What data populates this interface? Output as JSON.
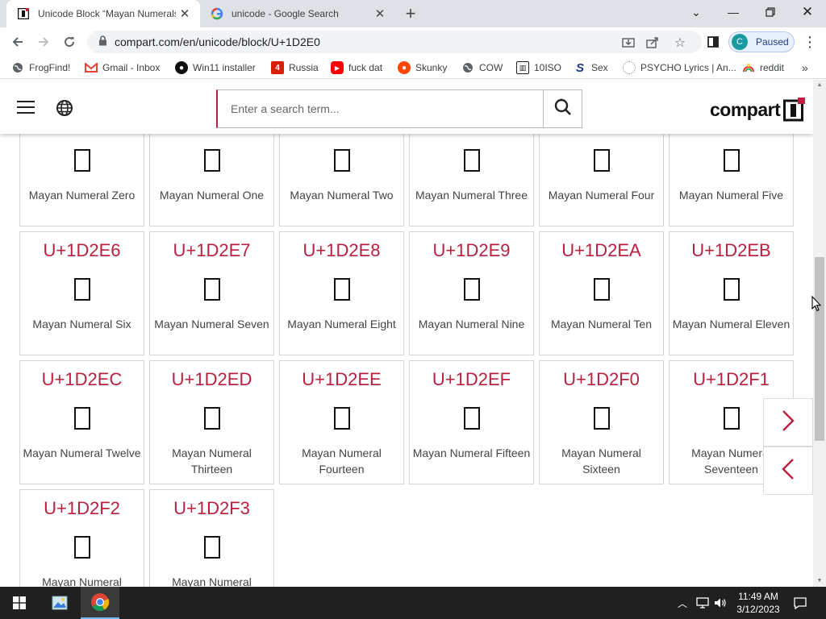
{
  "browser": {
    "tabs": [
      {
        "title": "Unicode Block “Mayan Numerals”",
        "active": true
      },
      {
        "title": "unicode - Google Search",
        "active": false
      }
    ],
    "url": "compart.com/en/unicode/block/U+1D2E0",
    "profile": {
      "initial": "C",
      "label": "Paused"
    },
    "bookmarks": [
      {
        "label": "FrogFind!",
        "icon": "globe-icon"
      },
      {
        "label": "Gmail - Inbox",
        "icon": "gmail-icon"
      },
      {
        "label": "Win11 installer",
        "icon": "github-icon"
      },
      {
        "label": "Russia",
        "icon": "russia-icon"
      },
      {
        "label": "fuck dat",
        "icon": "youtube-icon"
      },
      {
        "label": "Skunky",
        "icon": "reddit-icon"
      },
      {
        "label": "COW",
        "icon": "globe-icon"
      },
      {
        "label": "10ISO",
        "icon": "building-icon"
      },
      {
        "label": "Sex",
        "icon": "s-icon"
      },
      {
        "label": "PSYCHO Lyrics | An...",
        "icon": "loading-icon"
      },
      {
        "label": "reddit",
        "icon": "rainbow-icon"
      }
    ],
    "more_bookmarks": "»"
  },
  "site": {
    "search_placeholder": "Enter a search term...",
    "logo_text": "compart"
  },
  "characters": [
    {
      "code": "",
      "name": "Mayan Numeral Zero"
    },
    {
      "code": "",
      "name": "Mayan Numeral One"
    },
    {
      "code": "",
      "name": "Mayan Numeral Two"
    },
    {
      "code": "",
      "name": "Mayan Numeral Three"
    },
    {
      "code": "",
      "name": "Mayan Numeral Four"
    },
    {
      "code": "",
      "name": "Mayan Numeral Five"
    },
    {
      "code": "U+1D2E6",
      "name": "Mayan Numeral Six"
    },
    {
      "code": "U+1D2E7",
      "name": "Mayan Numeral Seven"
    },
    {
      "code": "U+1D2E8",
      "name": "Mayan Numeral Eight"
    },
    {
      "code": "U+1D2E9",
      "name": "Mayan Numeral Nine"
    },
    {
      "code": "U+1D2EA",
      "name": "Mayan Numeral Ten"
    },
    {
      "code": "U+1D2EB",
      "name": "Mayan Numeral Eleven"
    },
    {
      "code": "U+1D2EC",
      "name": "Mayan Numeral Twelve"
    },
    {
      "code": "U+1D2ED",
      "name": "Mayan Numeral Thirteen"
    },
    {
      "code": "U+1D2EE",
      "name": "Mayan Numeral Fourteen"
    },
    {
      "code": "U+1D2EF",
      "name": "Mayan Numeral Fifteen"
    },
    {
      "code": "U+1D2F0",
      "name": "Mayan Numeral Sixteen"
    },
    {
      "code": "U+1D2F1",
      "name": "Mayan Numeral Seventeen"
    },
    {
      "code": "U+1D2F2",
      "name": "Mayan Numeral"
    },
    {
      "code": "U+1D2F3",
      "name": "Mayan Numeral"
    }
  ],
  "taskbar": {
    "time": "11:49 AM",
    "date": "3/12/2023"
  },
  "colors": {
    "accent": "#b8213f",
    "taskbar": "#202020",
    "tabstrip": "#dee1e6"
  }
}
